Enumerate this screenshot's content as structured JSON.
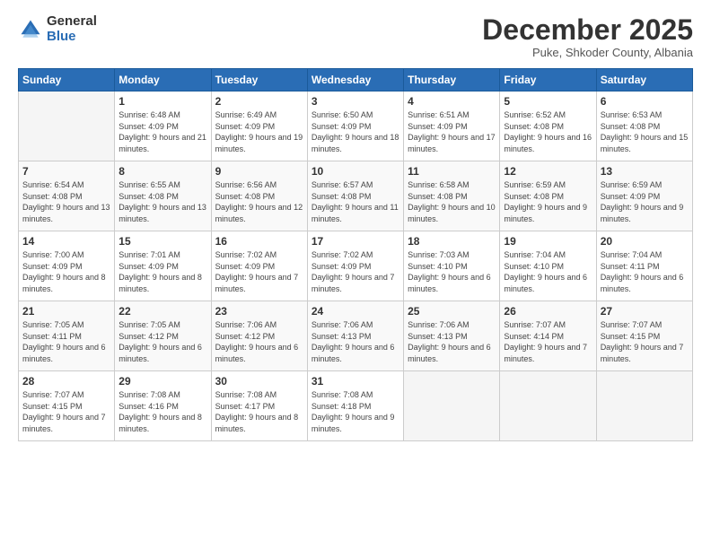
{
  "logo": {
    "general": "General",
    "blue": "Blue"
  },
  "header": {
    "month": "December 2025",
    "subtitle": "Puke, Shkoder County, Albania"
  },
  "weekdays": [
    "Sunday",
    "Monday",
    "Tuesday",
    "Wednesday",
    "Thursday",
    "Friday",
    "Saturday"
  ],
  "weeks": [
    [
      {
        "day": "",
        "sunrise": "",
        "sunset": "",
        "daylight": ""
      },
      {
        "day": "1",
        "sunrise": "6:48 AM",
        "sunset": "4:09 PM",
        "daylight": "9 hours and 21 minutes."
      },
      {
        "day": "2",
        "sunrise": "6:49 AM",
        "sunset": "4:09 PM",
        "daylight": "9 hours and 19 minutes."
      },
      {
        "day": "3",
        "sunrise": "6:50 AM",
        "sunset": "4:09 PM",
        "daylight": "9 hours and 18 minutes."
      },
      {
        "day": "4",
        "sunrise": "6:51 AM",
        "sunset": "4:09 PM",
        "daylight": "9 hours and 17 minutes."
      },
      {
        "day": "5",
        "sunrise": "6:52 AM",
        "sunset": "4:08 PM",
        "daylight": "9 hours and 16 minutes."
      },
      {
        "day": "6",
        "sunrise": "6:53 AM",
        "sunset": "4:08 PM",
        "daylight": "9 hours and 15 minutes."
      }
    ],
    [
      {
        "day": "7",
        "sunrise": "6:54 AM",
        "sunset": "4:08 PM",
        "daylight": "9 hours and 13 minutes."
      },
      {
        "day": "8",
        "sunrise": "6:55 AM",
        "sunset": "4:08 PM",
        "daylight": "9 hours and 13 minutes."
      },
      {
        "day": "9",
        "sunrise": "6:56 AM",
        "sunset": "4:08 PM",
        "daylight": "9 hours and 12 minutes."
      },
      {
        "day": "10",
        "sunrise": "6:57 AM",
        "sunset": "4:08 PM",
        "daylight": "9 hours and 11 minutes."
      },
      {
        "day": "11",
        "sunrise": "6:58 AM",
        "sunset": "4:08 PM",
        "daylight": "9 hours and 10 minutes."
      },
      {
        "day": "12",
        "sunrise": "6:59 AM",
        "sunset": "4:08 PM",
        "daylight": "9 hours and 9 minutes."
      },
      {
        "day": "13",
        "sunrise": "6:59 AM",
        "sunset": "4:09 PM",
        "daylight": "9 hours and 9 minutes."
      }
    ],
    [
      {
        "day": "14",
        "sunrise": "7:00 AM",
        "sunset": "4:09 PM",
        "daylight": "9 hours and 8 minutes."
      },
      {
        "day": "15",
        "sunrise": "7:01 AM",
        "sunset": "4:09 PM",
        "daylight": "9 hours and 8 minutes."
      },
      {
        "day": "16",
        "sunrise": "7:02 AM",
        "sunset": "4:09 PM",
        "daylight": "9 hours and 7 minutes."
      },
      {
        "day": "17",
        "sunrise": "7:02 AM",
        "sunset": "4:09 PM",
        "daylight": "9 hours and 7 minutes."
      },
      {
        "day": "18",
        "sunrise": "7:03 AM",
        "sunset": "4:10 PM",
        "daylight": "9 hours and 6 minutes."
      },
      {
        "day": "19",
        "sunrise": "7:04 AM",
        "sunset": "4:10 PM",
        "daylight": "9 hours and 6 minutes."
      },
      {
        "day": "20",
        "sunrise": "7:04 AM",
        "sunset": "4:11 PM",
        "daylight": "9 hours and 6 minutes."
      }
    ],
    [
      {
        "day": "21",
        "sunrise": "7:05 AM",
        "sunset": "4:11 PM",
        "daylight": "9 hours and 6 minutes."
      },
      {
        "day": "22",
        "sunrise": "7:05 AM",
        "sunset": "4:12 PM",
        "daylight": "9 hours and 6 minutes."
      },
      {
        "day": "23",
        "sunrise": "7:06 AM",
        "sunset": "4:12 PM",
        "daylight": "9 hours and 6 minutes."
      },
      {
        "day": "24",
        "sunrise": "7:06 AM",
        "sunset": "4:13 PM",
        "daylight": "9 hours and 6 minutes."
      },
      {
        "day": "25",
        "sunrise": "7:06 AM",
        "sunset": "4:13 PM",
        "daylight": "9 hours and 6 minutes."
      },
      {
        "day": "26",
        "sunrise": "7:07 AM",
        "sunset": "4:14 PM",
        "daylight": "9 hours and 7 minutes."
      },
      {
        "day": "27",
        "sunrise": "7:07 AM",
        "sunset": "4:15 PM",
        "daylight": "9 hours and 7 minutes."
      }
    ],
    [
      {
        "day": "28",
        "sunrise": "7:07 AM",
        "sunset": "4:15 PM",
        "daylight": "9 hours and 7 minutes."
      },
      {
        "day": "29",
        "sunrise": "7:08 AM",
        "sunset": "4:16 PM",
        "daylight": "9 hours and 8 minutes."
      },
      {
        "day": "30",
        "sunrise": "7:08 AM",
        "sunset": "4:17 PM",
        "daylight": "9 hours and 8 minutes."
      },
      {
        "day": "31",
        "sunrise": "7:08 AM",
        "sunset": "4:18 PM",
        "daylight": "9 hours and 9 minutes."
      },
      {
        "day": "",
        "sunrise": "",
        "sunset": "",
        "daylight": ""
      },
      {
        "day": "",
        "sunrise": "",
        "sunset": "",
        "daylight": ""
      },
      {
        "day": "",
        "sunrise": "",
        "sunset": "",
        "daylight": ""
      }
    ]
  ]
}
